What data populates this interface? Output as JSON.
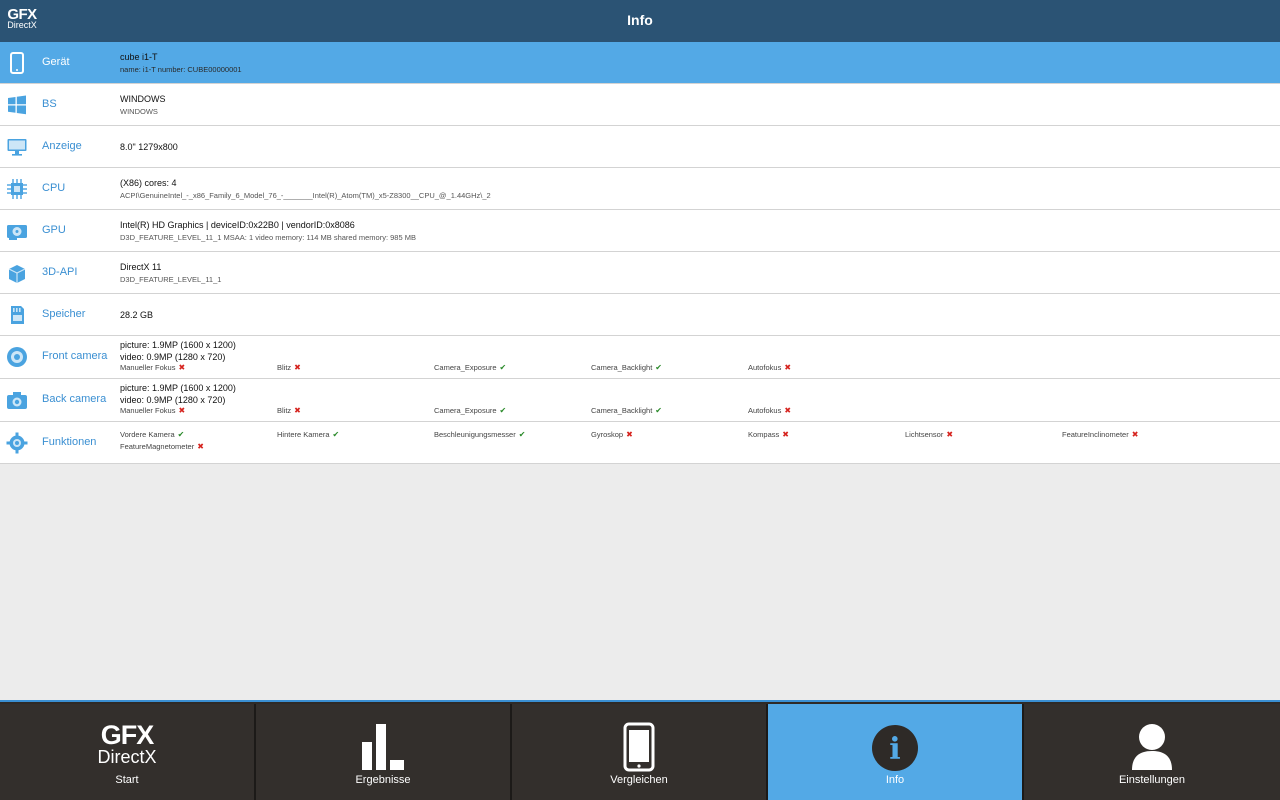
{
  "app": {
    "logo_top": "GFX",
    "logo_bottom": "DirectX",
    "title": "Info"
  },
  "rows": {
    "geraet": {
      "label": "Gerät",
      "line1": "cube i1-T",
      "line2": "name: i1-T number: CUBE00000001"
    },
    "bs": {
      "label": "BS",
      "line1": "WINDOWS",
      "line2": "WINDOWS"
    },
    "anzeige": {
      "label": "Anzeige",
      "line1": "8.0\" 1279x800"
    },
    "cpu": {
      "label": "CPU",
      "line1": "(X86) cores: 4",
      "line2": "ACPI\\GenuineIntel_-_x86_Family_6_Model_76_-_______Intel(R)_Atom(TM)_x5-Z8300__CPU_@_1.44GHz\\_2"
    },
    "gpu": {
      "label": "GPU",
      "line1": "Intel(R) HD Graphics | deviceID:0x22B0 | vendorID:0x8086",
      "line2": "D3D_FEATURE_LEVEL_11_1 MSAA: 1 video memory: 114 MB shared memory: 985 MB"
    },
    "api": {
      "label": "3D-API",
      "line1": "DirectX 11",
      "line2": "D3D_FEATURE_LEVEL_11_1"
    },
    "speicher": {
      "label": "Speicher",
      "line1": "28.2 GB"
    },
    "front": {
      "label": "Front camera",
      "line1": "picture: 1.9MP (1600 x 1200)",
      "line2": "video: 0.9MP (1280 x 720)",
      "features": [
        {
          "name": "Manueller Fokus",
          "ok": false
        },
        {
          "name": "Blitz",
          "ok": false
        },
        {
          "name": "Camera_Exposure",
          "ok": true
        },
        {
          "name": "Camera_Backlight",
          "ok": true
        },
        {
          "name": "Autofokus",
          "ok": false
        }
      ]
    },
    "back": {
      "label": "Back camera",
      "line1": "picture: 1.9MP (1600 x 1200)",
      "line2": "video: 0.9MP (1280 x 720)",
      "features": [
        {
          "name": "Manueller Fokus",
          "ok": false
        },
        {
          "name": "Blitz",
          "ok": false
        },
        {
          "name": "Camera_Exposure",
          "ok": true
        },
        {
          "name": "Camera_Backlight",
          "ok": true
        },
        {
          "name": "Autofokus",
          "ok": false
        }
      ]
    },
    "funktionen": {
      "label": "Funktionen",
      "features": [
        {
          "name": "Vordere Kamera",
          "ok": true
        },
        {
          "name": "Hintere Kamera",
          "ok": true
        },
        {
          "name": "Beschleunigungsmesser",
          "ok": true
        },
        {
          "name": "Gyroskop",
          "ok": false
        },
        {
          "name": "Kompass",
          "ok": false
        },
        {
          "name": "Lichtsensor",
          "ok": false
        },
        {
          "name": "FeatureInclinometer",
          "ok": false
        },
        {
          "name": "FeatureMagnetometer",
          "ok": false
        }
      ]
    }
  },
  "marks": {
    "ok": "✔",
    "bad": "✖"
  },
  "nav": {
    "start": {
      "label": "Start",
      "logo_top": "GFX",
      "logo_bottom": "DirectX"
    },
    "ergebnisse": {
      "label": "Ergebnisse"
    },
    "vergleichen": {
      "label": "Vergleichen"
    },
    "info": {
      "label": "Info",
      "glyph": "i"
    },
    "einstellungen": {
      "label": "Einstellungen"
    }
  },
  "colors": {
    "header": "#2b5374",
    "accent": "#53a9e6",
    "label": "#3a8fd2",
    "nav_bg": "#332f2c",
    "ok": "#2a8a2a",
    "bad": "#d6241f"
  }
}
